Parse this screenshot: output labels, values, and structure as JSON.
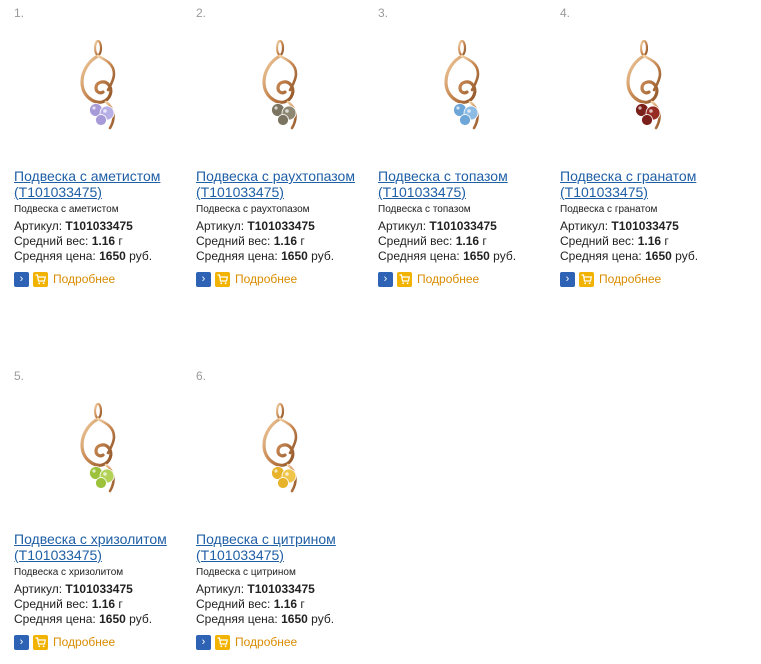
{
  "labels": {
    "article": "Артикул:",
    "weight": "Средний вес:",
    "price": "Средняя цена:",
    "weight_unit": "г",
    "price_unit": "руб.",
    "more": "Подробнее"
  },
  "items": [
    {
      "num": "1.",
      "title_line1": "Подвеска с аметистом",
      "title_line2": "(T101033475)",
      "desc": "Подвеска с аметистом",
      "article": "T101033475",
      "weight": "1.16",
      "price": "1650",
      "stone_color": "#a79ad8",
      "stone_color_2": "#b7b0e6"
    },
    {
      "num": "2.",
      "title_line1": "Подвеска с раухтопазом",
      "title_line2": "(T101033475)",
      "desc": "Подвеска с раухтопазом",
      "article": "T101033475",
      "weight": "1.16",
      "price": "1650",
      "stone_color": "#7a7461",
      "stone_color_2": "#8e8872"
    },
    {
      "num": "3.",
      "title_line1": "Подвеска с топазом",
      "title_line2": "(T101033475)",
      "desc": "Подвеска с топазом",
      "article": "T101033475",
      "weight": "1.16",
      "price": "1650",
      "stone_color": "#6fa6d8",
      "stone_color_2": "#8cbbe4"
    },
    {
      "num": "4.",
      "title_line1": "Подвеска с гранатом",
      "title_line2": "(T101033475)",
      "desc": "Подвеска с гранатом",
      "article": "T101033475",
      "weight": "1.16",
      "price": "1650",
      "stone_color": "#7a1f1a",
      "stone_color_2": "#962c22"
    },
    {
      "num": "5.",
      "title_line1": "Подвеска с хризолитом",
      "title_line2": "(T101033475)",
      "desc": "Подвеска с хризолитом",
      "article": "T101033475",
      "weight": "1.16",
      "price": "1650",
      "stone_color": "#9cc23c",
      "stone_color_2": "#b2d257"
    },
    {
      "num": "6.",
      "title_line1": "Подвеска с цитрином",
      "title_line2": "(T101033475)",
      "desc": "Подвеска с цитрином",
      "article": "T101033475",
      "weight": "1.16",
      "price": "1650",
      "stone_color": "#e6b32b",
      "stone_color_2": "#f0c64a"
    }
  ]
}
